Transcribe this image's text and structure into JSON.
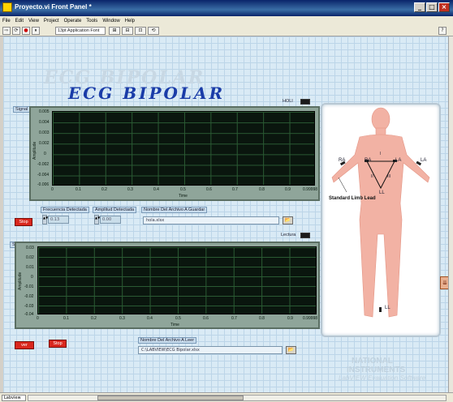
{
  "window": {
    "title": "Proyecto.vi Front Panel *"
  },
  "menu": [
    "File",
    "Edit",
    "View",
    "Project",
    "Operate",
    "Tools",
    "Window",
    "Help"
  ],
  "toolbar": {
    "font": "13pt Application Font",
    "run_arrow": "⇨",
    "run_cont": "⟳",
    "abort": "●",
    "pause": "⏸"
  },
  "panel": {
    "title": "ECG BIPOLAR",
    "title_shadow": "ECG BIPOLAR"
  },
  "graph1": {
    "label": "Signal",
    "indicator_label": "HOLI",
    "y_ticks": [
      "0.005",
      "0.004",
      "0.003",
      "0.002",
      "0",
      "-0.002",
      "-0.004",
      "-0.006"
    ],
    "x_ticks": [
      "0",
      "0.1",
      "0.2",
      "0.3",
      "0.4",
      "0.5",
      "0.6",
      "0.7",
      "0.8",
      "0.9",
      "0.99998"
    ],
    "y_title": "Amplitude",
    "x_title": "Time"
  },
  "controls": {
    "stop_label": "Stop",
    "freq_label": "Frecuencia Detectada",
    "freq_value": "0.13",
    "amp_label": "Amplitud Detectada",
    "amp_value": "0.00",
    "file_label": "Nombre Del Archivo A Guardar",
    "file_value": "hola.xlsx"
  },
  "graph2": {
    "label": "Signal 2",
    "indicator_label": "Lectura",
    "y_ticks": [
      "0.03",
      "0.02",
      "0.01",
      "0",
      "-0.01",
      "-0.02",
      "-0.03",
      "-0.04"
    ],
    "x_ticks": [
      "0",
      "0.1",
      "0.2",
      "0.3",
      "0.4",
      "0.5",
      "0.6",
      "0.7",
      "0.8",
      "0.9",
      "0.99998"
    ],
    "y_title": "Amplitude",
    "x_title": "Time"
  },
  "bottom": {
    "red_btn_left": "ver",
    "red_btn_right": "Stop",
    "read_label": "Nombre Del Archivo A Leer",
    "read_value": "C:\\LABVIEW\\ECG Bipolar.xlsx"
  },
  "einthoven": {
    "ra_outer": "RA",
    "ra_inner": "RA",
    "la_inner": "LA",
    "la_outer": "LA",
    "lead_i": "I",
    "lead_ii": "II",
    "lead_iii": "III",
    "ll_inner": "LL",
    "ll_foot": "LL",
    "standard": "Standard Limb Lead"
  },
  "branding": {
    "ni_line1": "NATIONAL",
    "ni_line2": "INSTRUMENTS",
    "ni_line3": "LabVIEW Evaluation Software"
  },
  "status": {
    "left": "Labview"
  },
  "colors": {
    "plot_bg": "#0a160e",
    "grid": "#2a5a33",
    "stop_red": "#d9271d",
    "title_blue": "#1a3ca8",
    "skin": "#f2b2a4"
  }
}
